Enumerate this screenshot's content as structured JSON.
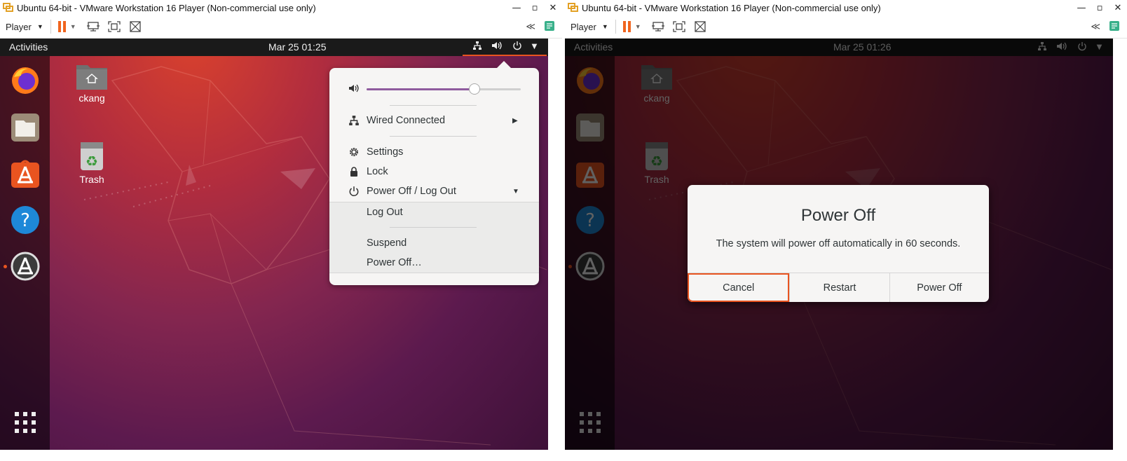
{
  "left": {
    "window_title": "Ubuntu 64-bit - VMware Workstation 16 Player (Non-commercial use only)",
    "toolbar": {
      "player_label": "Player"
    },
    "topbar": {
      "activities": "Activities",
      "clock": "Mar 25  01:25"
    },
    "desktop_icons": {
      "home": "ckang",
      "trash": "Trash"
    },
    "menu": {
      "volume_percent": 70,
      "wired": "Wired Connected",
      "settings": "Settings",
      "lock": "Lock",
      "power_off_logout": "Power Off / Log Out",
      "log_out": "Log Out",
      "suspend": "Suspend",
      "power_off": "Power Off…"
    }
  },
  "right": {
    "window_title": "Ubuntu 64-bit - VMware Workstation 16 Player (Non-commercial use only)",
    "toolbar": {
      "player_label": "Player"
    },
    "topbar": {
      "activities": "Activities",
      "clock": "Mar 25  01:26"
    },
    "desktop_icons": {
      "home": "ckang",
      "trash": "Trash"
    },
    "dialog": {
      "title": "Power Off",
      "message": "The system will power off automatically in 60 seconds.",
      "cancel": "Cancel",
      "restart": "Restart",
      "power_off": "Power Off"
    }
  },
  "colors": {
    "accent": "#e95420",
    "vmware_pause": "#f0641e",
    "slider_fill": "#8f5b9e"
  }
}
